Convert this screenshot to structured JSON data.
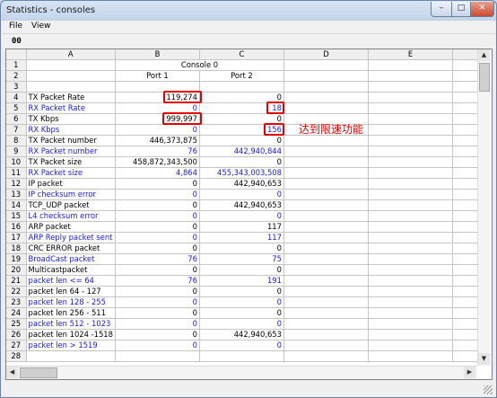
{
  "window": {
    "title": "Statistics - consoles",
    "min": "–",
    "max": "□",
    "close": "✕"
  },
  "menu": [
    "File",
    "View"
  ],
  "toolbar": {
    "value": "00"
  },
  "columns": [
    "A",
    "B",
    "C",
    "D",
    "E"
  ],
  "console_title": "Console 0",
  "port_headers": [
    "Port 1",
    "Port 2"
  ],
  "rows": [
    {
      "n": "4",
      "label": "TX Packet Rate",
      "p1": "119,274",
      "p2": "0",
      "blue": false
    },
    {
      "n": "5",
      "label": "RX Packet Rate",
      "p1": "0",
      "p2": "18",
      "blue": true
    },
    {
      "n": "6",
      "label": "TX Kbps",
      "p1": "999,997",
      "p2": "0",
      "blue": false
    },
    {
      "n": "7",
      "label": "RX Kbps",
      "p1": "0",
      "p2": "156",
      "blue": true
    },
    {
      "n": "8",
      "label": "TX Packet number",
      "p1": "446,373,875",
      "p2": "0",
      "blue": false
    },
    {
      "n": "9",
      "label": "RX Packet number",
      "p1": "76",
      "p2": "442,940,844",
      "blue": true
    },
    {
      "n": "10",
      "label": "TX Packet size",
      "p1": "458,872,343,500",
      "p2": "0",
      "blue": false
    },
    {
      "n": "11",
      "label": "RX Packet size",
      "p1": "4,864",
      "p2": "455,343,003,508",
      "blue": true
    },
    {
      "n": "12",
      "label": "IP packet",
      "p1": "0",
      "p2": "442,940,653",
      "blue": false
    },
    {
      "n": "13",
      "label": "IP checksum error",
      "p1": "0",
      "p2": "0",
      "blue": true
    },
    {
      "n": "14",
      "label": "TCP_UDP packet",
      "p1": "0",
      "p2": "442,940,653",
      "blue": false
    },
    {
      "n": "15",
      "label": "L4 checksum error",
      "p1": "0",
      "p2": "0",
      "blue": true
    },
    {
      "n": "16",
      "label": "ARP packet",
      "p1": "0",
      "p2": "117",
      "blue": false
    },
    {
      "n": "17",
      "label": "ARP Reply packet sent",
      "p1": "0",
      "p2": "117",
      "blue": true
    },
    {
      "n": "18",
      "label": "CRC ERROR packet",
      "p1": "0",
      "p2": "0",
      "blue": false
    },
    {
      "n": "19",
      "label": "BroadCast packet",
      "p1": "76",
      "p2": "75",
      "blue": true
    },
    {
      "n": "20",
      "label": "Multicastpacket",
      "p1": "0",
      "p2": "0",
      "blue": false
    },
    {
      "n": "21",
      "label": "packet len <= 64",
      "p1": "76",
      "p2": "191",
      "blue": true
    },
    {
      "n": "22",
      "label": "packet len 64 - 127",
      "p1": "0",
      "p2": "0",
      "blue": false
    },
    {
      "n": "23",
      "label": "packet len 128 - 255",
      "p1": "0",
      "p2": "0",
      "blue": true
    },
    {
      "n": "24",
      "label": "packet len 256 - 511",
      "p1": "0",
      "p2": "0",
      "blue": false
    },
    {
      "n": "25",
      "label": "packet len 512 - 1023",
      "p1": "0",
      "p2": "0",
      "blue": true
    },
    {
      "n": "26",
      "label": "packet len 1024 -1518",
      "p1": "0",
      "p2": "442,940,653",
      "blue": false
    },
    {
      "n": "27",
      "label": "packet len > 1519",
      "p1": "0",
      "p2": "0",
      "blue": true
    },
    {
      "n": "28",
      "label": "",
      "p1": "",
      "p2": "",
      "blue": false
    }
  ],
  "annotation": "达到限速功能",
  "colors": {
    "blue_text": "#1a1adc",
    "highlight": "#e00000"
  }
}
